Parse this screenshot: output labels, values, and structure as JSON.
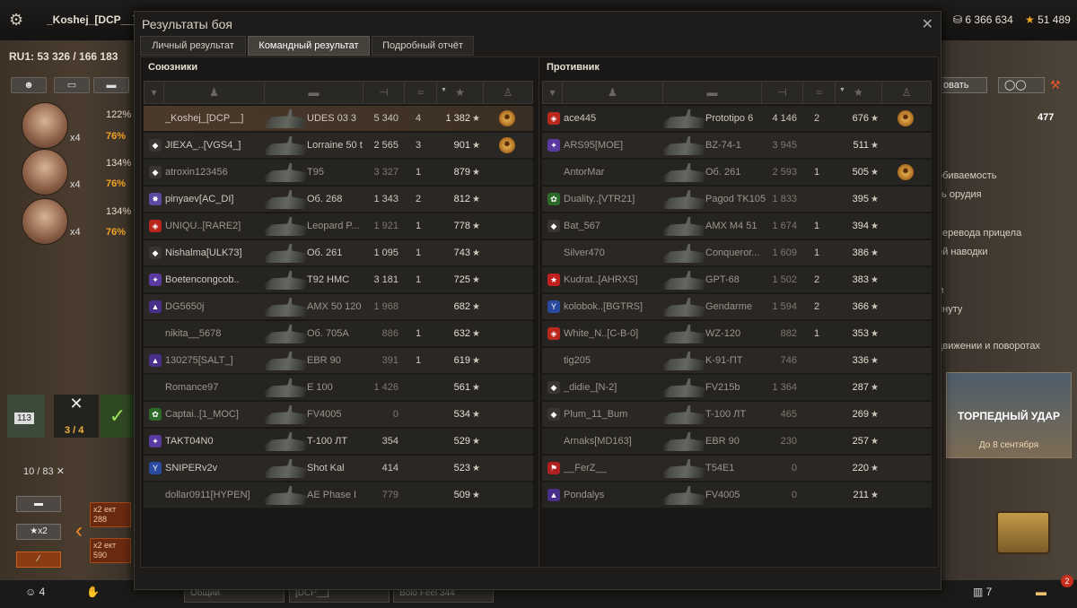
{
  "header": {
    "player_name": "_Koshej_[DCP__]",
    "credits": "6 366 634",
    "free_xp": "51 489"
  },
  "left_panel": {
    "server_line": "RU1: 53 326  /  166 183",
    "crew": [
      {
        "x": "x4",
        "stat1": "122%",
        "stat2": "76%"
      },
      {
        "x": "x4",
        "stat1": "134%",
        "stat2": "76%"
      },
      {
        "x": "x4",
        "stat1": "134%",
        "stat2": "76%"
      }
    ],
    "depot_count": "113",
    "expand_frac": "3 / 4",
    "slots": "10 / 83",
    "multiplier": "x2",
    "bonus1": "x2 ект 288",
    "bonus2": "x2 ект 590"
  },
  "right_panel": {
    "button1": "овать",
    "value": "477",
    "lines": [
      "обиваемость",
      "ть орудия",
      "перевода прицела",
      "ой наводки",
      "м",
      "инуту",
      "движении и поворотах"
    ],
    "promo_title": "ТОРПЕДНЫЙ УДАР",
    "promo_sub": "До 8 сентября"
  },
  "bottom_bar": {
    "platoon_count": "4",
    "chat_tab1": "Общий",
    "chat_tab2": "[DCP__]",
    "chat_tab3": "Bolo Feel 344",
    "count_right": "7",
    "notif": "2"
  },
  "dialog": {
    "title": "Результаты боя",
    "tabs": [
      "Личный результат",
      "Командный результат",
      "Подробный отчёт"
    ],
    "active_tab": 1,
    "allies_title": "Союзники",
    "enemies_title": "Противник",
    "allies": [
      {
        "name": "_Koshej_[DCP__]",
        "tank": "UDES 03 3",
        "damage": "5 340",
        "kills": "4",
        "xp": "1 382",
        "medal": true,
        "me": true,
        "clan": "",
        "dim": false
      },
      {
        "name": "JIEXA_..[VGS4_]",
        "tank": "Lorraine 50 t",
        "damage": "2 565",
        "kills": "3",
        "xp": "901",
        "medal": true,
        "clan": "rank",
        "dim": false
      },
      {
        "name": "atroxin123456",
        "tank": "T95",
        "damage": "3 327",
        "kills": "1",
        "xp": "879",
        "medal": false,
        "clan": "rank",
        "dim": true
      },
      {
        "name": "pinyaev[AC_DI]",
        "tank": "Об. 268",
        "damage": "1 343",
        "kills": "2",
        "xp": "812",
        "medal": false,
        "clan": "star",
        "dim": false
      },
      {
        "name": "UNIQU..[RARE2]",
        "tank": "Leopard P...",
        "damage": "1 921",
        "kills": "1",
        "xp": "778",
        "medal": false,
        "clan": "red",
        "dim": true
      },
      {
        "name": "Nishalma[ULK73]",
        "tank": "Об. 261",
        "damage": "1 095",
        "kills": "1",
        "xp": "743",
        "medal": false,
        "clan": "rank",
        "dim": false
      },
      {
        "name": "Boetencongcob..",
        "tank": "T92 HMC",
        "damage": "3 181",
        "kills": "1",
        "xp": "725",
        "medal": false,
        "clan": "purple",
        "dim": false
      },
      {
        "name": "DG5650j",
        "tank": "AMX 50 120",
        "damage": "1 968",
        "kills": "",
        "xp": "682",
        "medal": false,
        "clan": "violet",
        "dim": true
      },
      {
        "name": "nikita__5678",
        "tank": "Об. 705А",
        "damage": "886",
        "kills": "1",
        "xp": "632",
        "medal": false,
        "clan": "",
        "dim": true
      },
      {
        "name": "130275[SALT_]",
        "tank": "EBR 90",
        "damage": "391",
        "kills": "1",
        "xp": "619",
        "medal": false,
        "clan": "violet",
        "dim": true
      },
      {
        "name": "Romance97",
        "tank": "E 100",
        "damage": "1 426",
        "kills": "",
        "xp": "561",
        "medal": false,
        "clan": "",
        "dim": true
      },
      {
        "name": "Captai..[1_MOC]",
        "tank": "FV4005",
        "damage": "0",
        "kills": "",
        "xp": "534",
        "medal": false,
        "clan": "green",
        "dim": true
      },
      {
        "name": "TAKT04N0",
        "tank": "T-100 ЛТ",
        "damage": "354",
        "kills": "",
        "xp": "529",
        "medal": false,
        "clan": "purple",
        "dim": false
      },
      {
        "name": "SNIPERv2v",
        "tank": "Shot Kal",
        "damage": "414",
        "kills": "",
        "xp": "523",
        "medal": false,
        "clan": "blue",
        "dim": false
      },
      {
        "name": "dollar0911[HYPEN]",
        "tank": "AE Phase I",
        "damage": "779",
        "kills": "",
        "xp": "509",
        "medal": false,
        "clan": "",
        "dim": true
      }
    ],
    "enemies": [
      {
        "name": "ace445",
        "tank": "Prototipo 6",
        "damage": "4 146",
        "kills": "2",
        "xp": "676",
        "medal": true,
        "clan": "red",
        "dim": false
      },
      {
        "name": "ARS95[MOE]",
        "tank": "BZ-74-1",
        "damage": "3 945",
        "kills": "",
        "xp": "511",
        "medal": false,
        "clan": "purple",
        "dim": true
      },
      {
        "name": "AntorMar",
        "tank": "Об. 261",
        "damage": "2 593",
        "kills": "1",
        "xp": "505",
        "medal": true,
        "clan": "",
        "dim": true
      },
      {
        "name": "Duality..[VTR21]",
        "tank": "Pagod TK105",
        "damage": "1 833",
        "kills": "",
        "xp": "395",
        "medal": false,
        "clan": "green",
        "dim": true
      },
      {
        "name": "Bat_567",
        "tank": "AMX M4 51",
        "damage": "1 674",
        "kills": "1",
        "xp": "394",
        "medal": false,
        "clan": "rank",
        "dim": true
      },
      {
        "name": "Silver470",
        "tank": "Conqueror...",
        "damage": "1 609",
        "kills": "1",
        "xp": "386",
        "medal": false,
        "clan": "",
        "dim": true
      },
      {
        "name": "Kudrat..[AHRXS]",
        "tank": "GPT-68",
        "damage": "1 502",
        "kills": "2",
        "xp": "383",
        "medal": false,
        "clan": "redstar",
        "dim": true
      },
      {
        "name": "kolobok..[BGTRS]",
        "tank": "Gendarme",
        "damage": "1 594",
        "kills": "2",
        "xp": "366",
        "medal": false,
        "clan": "blue",
        "dim": true
      },
      {
        "name": "White_N..[C-B-0]",
        "tank": "WZ-120",
        "damage": "882",
        "kills": "1",
        "xp": "353",
        "medal": false,
        "clan": "red",
        "dim": true
      },
      {
        "name": "tig205",
        "tank": "K-91-ПТ",
        "damage": "746",
        "kills": "",
        "xp": "336",
        "medal": false,
        "clan": "",
        "dim": true
      },
      {
        "name": "_didie_[N-2]",
        "tank": "FV215b",
        "damage": "1 364",
        "kills": "",
        "xp": "287",
        "medal": false,
        "clan": "rank",
        "dim": true
      },
      {
        "name": "Plum_11_Bum",
        "tank": "T-100 ЛТ",
        "damage": "465",
        "kills": "",
        "xp": "269",
        "medal": false,
        "clan": "rank",
        "dim": true
      },
      {
        "name": "Arnaks[MD163]",
        "tank": "EBR 90",
        "damage": "230",
        "kills": "",
        "xp": "257",
        "medal": false,
        "clan": "",
        "dim": true
      },
      {
        "name": "__FerZ__",
        "tank": "T54E1",
        "damage": "0",
        "kills": "",
        "xp": "220",
        "medal": false,
        "clan": "redflag",
        "dim": true
      },
      {
        "name": "Pondalys",
        "tank": "FV4005",
        "damage": "0",
        "kills": "",
        "xp": "211",
        "medal": false,
        "clan": "violet",
        "dim": true
      }
    ]
  },
  "colors": {
    "accent_orange": "#f2a423",
    "panel_bg": "#191816",
    "row_bg": "#262421"
  }
}
